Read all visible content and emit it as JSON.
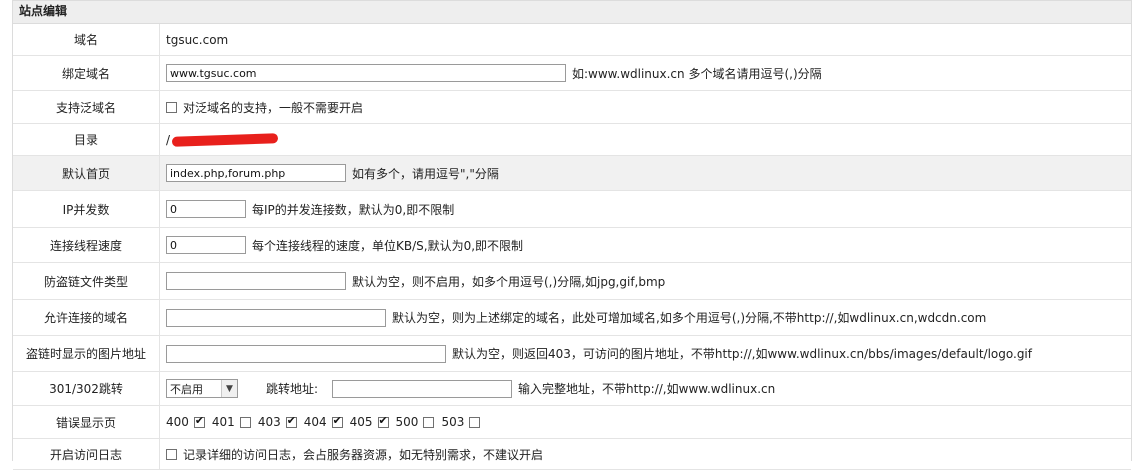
{
  "panel": {
    "title": "站点编辑"
  },
  "rows": {
    "domain": {
      "label": "域名",
      "value": "tgsuc.com"
    },
    "bind": {
      "label": "绑定域名",
      "value": "www.tgsuc.com",
      "note": "如:www.wdlinux.cn 多个域名请用逗号(,)分隔"
    },
    "wildcard": {
      "label": "支持泛域名",
      "checked": false,
      "note": "对泛域名的支持，一般不需要开启"
    },
    "dir": {
      "label": "目录",
      "value": "/"
    },
    "index": {
      "label": "默认首页",
      "value": "index.php,forum.php",
      "note": "如有多个，请用逗号\",\"分隔"
    },
    "ipconn": {
      "label": "IP并发数",
      "value": "0",
      "note": "每IP的并发连接数，默认为0,即不限制"
    },
    "speed": {
      "label": "连接线程速度",
      "value": "0",
      "note": "每个连接线程的速度，单位KB/S,默认为0,即不限制"
    },
    "hotlink_types": {
      "label": "防盗链文件类型",
      "value": "",
      "note": "默认为空，则不启用，如多个用逗号(,)分隔,如jpg,gif,bmp"
    },
    "allowed_domains": {
      "label": "允许连接的域名",
      "value": "",
      "note": "默认为空，则为上述绑定的域名，此处可增加域名,如多个用逗号(,)分隔,不带http://,如wdlinux.cn,wdcdn.com"
    },
    "hotlink_image": {
      "label": "盗链时显示的图片地址",
      "value": "",
      "note": "默认为空，则返回403，可访问的图片地址，不带http://,如www.wdlinux.cn/bbs/images/default/logo.gif"
    },
    "redirect": {
      "label": "301/302跳转",
      "select": "不启用",
      "target_label": "跳转地址:",
      "target_value": "",
      "note": "输入完整地址，不带http://,如www.wdlinux.cn"
    },
    "errpages": {
      "label": "错误显示页",
      "items": [
        {
          "code": "400",
          "checked": true
        },
        {
          "code": "401",
          "checked": false
        },
        {
          "code": "403",
          "checked": true
        },
        {
          "code": "404",
          "checked": true
        },
        {
          "code": "405",
          "checked": true
        },
        {
          "code": "500",
          "checked": false
        },
        {
          "code": "503",
          "checked": false
        }
      ]
    },
    "accesslog": {
      "label": "开启访问日志",
      "checked": false,
      "note": "记录详细的访问日志，会占服务器资源，如无特别需求，不建议开启"
    }
  }
}
